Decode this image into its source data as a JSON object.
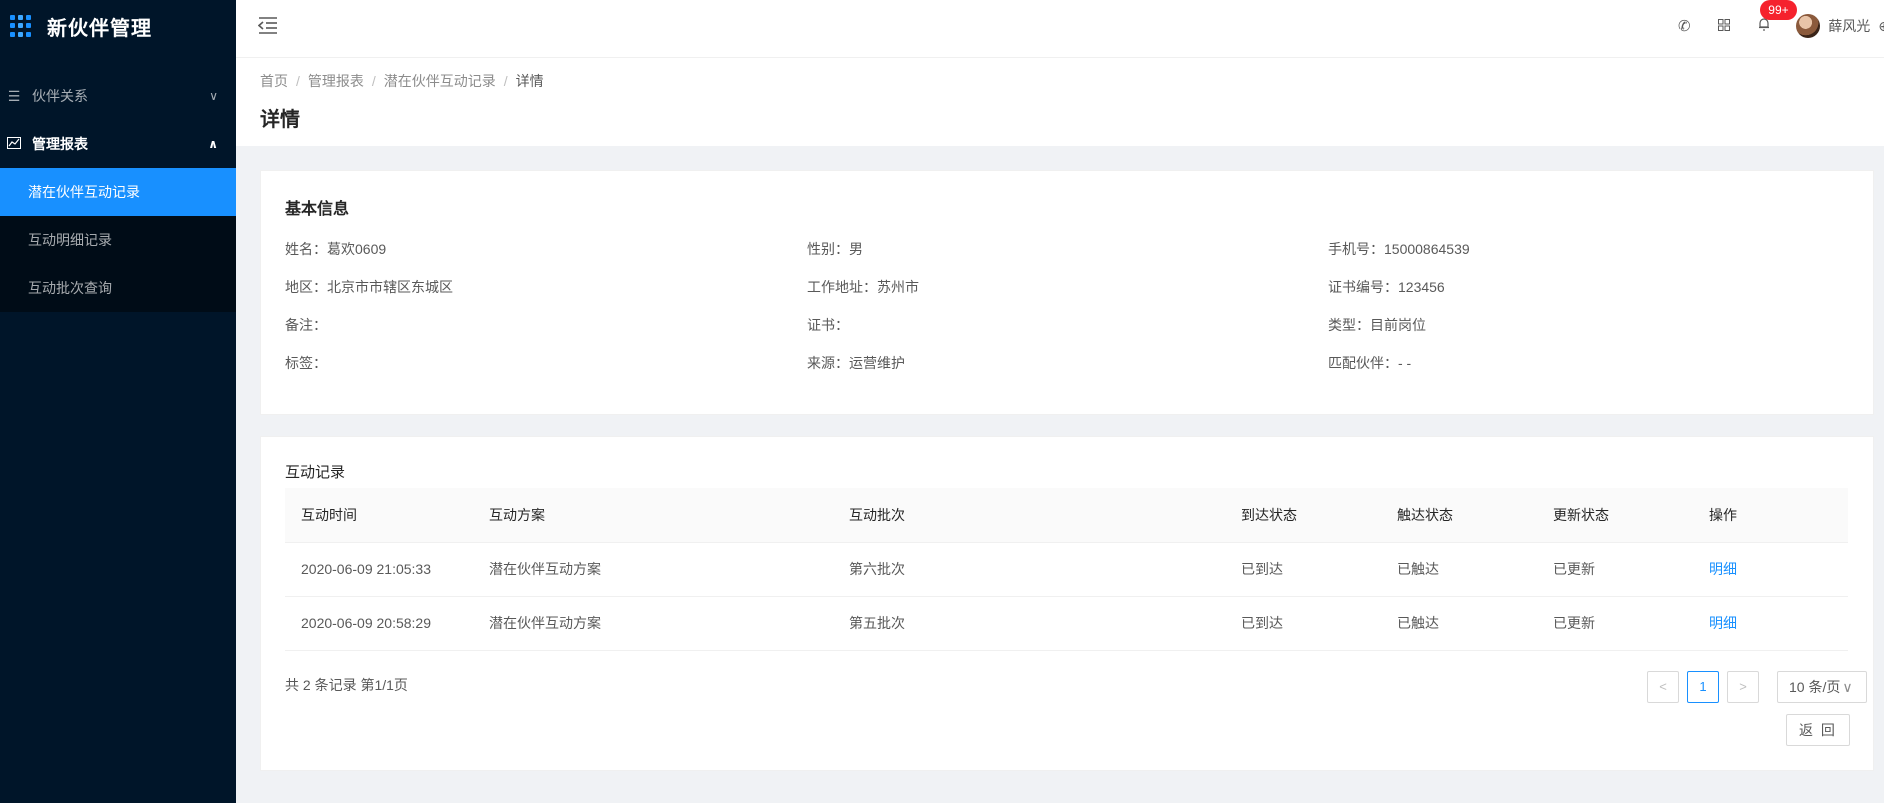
{
  "app": {
    "title": "新伙伴管理"
  },
  "sidebar": {
    "items": [
      {
        "label": "伙伴关系",
        "icon": "list-icon",
        "arrow": "⌄"
      },
      {
        "label": "管理报表",
        "icon": "line-chart-icon",
        "arrow": "⌃"
      }
    ],
    "subitems": [
      {
        "label": "潜在伙伴互动记录"
      },
      {
        "label": "互动明细记录"
      },
      {
        "label": "互动批次查询"
      }
    ]
  },
  "header": {
    "badge": "99+",
    "user": "薛风光"
  },
  "breadcrumb": [
    "首页",
    "管理报表",
    "潜在伙伴互动记录",
    "详情"
  ],
  "page_title": "详情",
  "basic_info": {
    "title": "基本信息",
    "fields": [
      "姓名：葛欢0609",
      "性别：男",
      "手机号：15000864539",
      "地区：北京市市辖区东城区",
      "工作地址：苏州市",
      "证书编号：123456",
      "备注：",
      "证书：",
      "类型：目前岗位",
      "标签：",
      "来源：运营维护",
      "匹配伙伴：- -"
    ]
  },
  "records": {
    "title": "互动记录",
    "columns": [
      "互动时间",
      "互动方案",
      "互动批次",
      "到达状态",
      "触达状态",
      "更新状态",
      "操作"
    ],
    "rows": [
      [
        "2020-06-09 21:05:33",
        "潜在伙伴互动方案",
        "第六批次",
        "已到达",
        "已触达",
        "已更新",
        "明细"
      ],
      [
        "2020-06-09 20:58:29",
        "潜在伙伴互动方案",
        "第五批次",
        "已到达",
        "已触达",
        "已更新",
        "明细"
      ]
    ],
    "total": "共 2 条记录 第1/1页",
    "page": "1",
    "page_size": "10 条/页",
    "prev": "<",
    "next": ">"
  },
  "back_label": "返 回",
  "colors": {
    "sidebar": "#001529",
    "accent": "#1890ff",
    "badge": "#f5222d"
  }
}
